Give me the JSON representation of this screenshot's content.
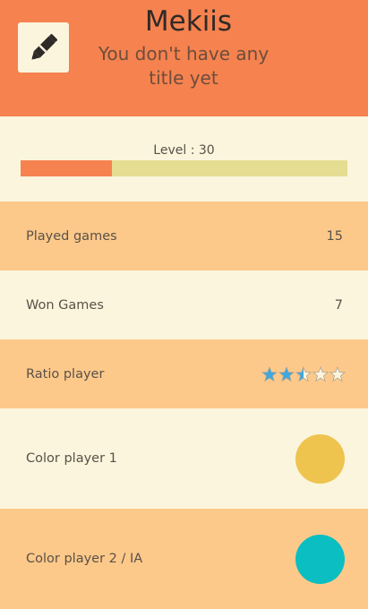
{
  "profile": {
    "name": "Mekiis",
    "title_line1": "You don't have any",
    "title_line2": "title yet"
  },
  "level": {
    "label": "Level : 30",
    "progress": 0.28
  },
  "stats": {
    "played_label": "Played games",
    "played_value": "15",
    "won_label": "Won Games",
    "won_value": "7",
    "ratio_label": "Ratio player",
    "ratio_stars": 2.5,
    "ratio_max": 5
  },
  "colors": {
    "player1_label": "Color player 1",
    "player1_color": "#eec44f",
    "player2_label": "Color player 2 / IA",
    "player2_color": "#0bbec1"
  },
  "icons": {
    "edit": "pencil-icon",
    "star": "star-icon"
  },
  "theme": {
    "header": "#f5824f",
    "cream": "#fbf5dd",
    "orange_row": "#fdc98a",
    "star_fill": "#3fa8de"
  }
}
